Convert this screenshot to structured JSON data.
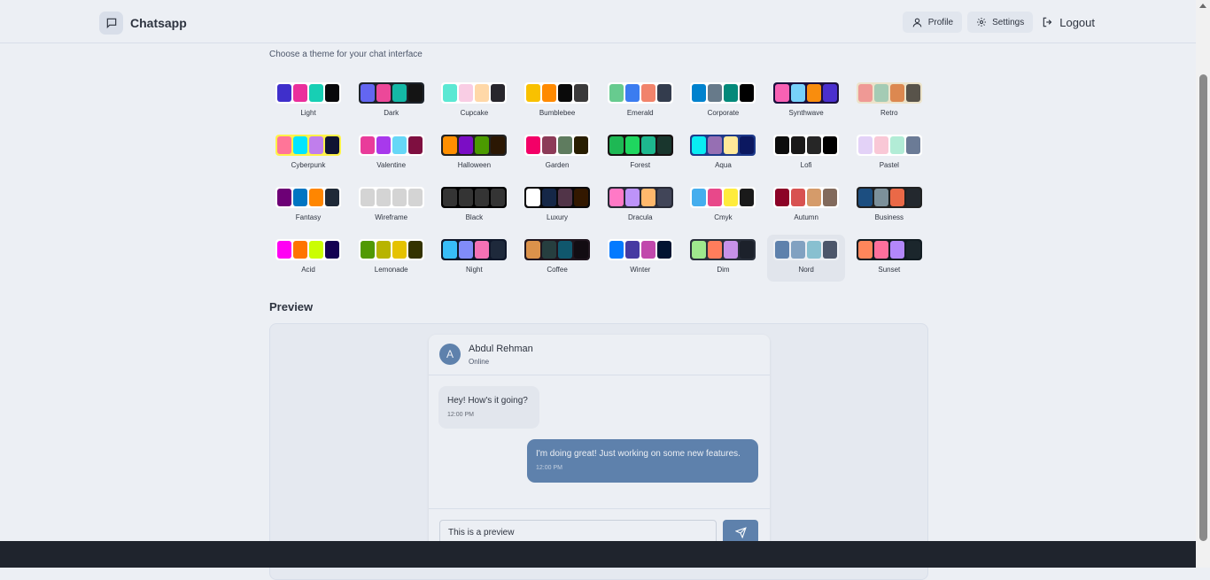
{
  "nav": {
    "brand": "Chatsapp",
    "profile": "Profile",
    "settings": "Settings",
    "logout": "Logout"
  },
  "subtitle": "Choose a theme for your chat interface",
  "selected_theme": "Nord",
  "themes": [
    {
      "name": "Light",
      "frame": "#ffffff",
      "colors": [
        "#3f2fcb",
        "#ea2f9c",
        "#17cfb4",
        "#09090b"
      ]
    },
    {
      "name": "Dark",
      "frame": "#1d232a",
      "colors": [
        "#6366f1",
        "#ec4899",
        "#14b8a6",
        "#141414"
      ]
    },
    {
      "name": "Cupcake",
      "frame": "#ffffff",
      "colors": [
        "#5be8d3",
        "#f9cde4",
        "#ffd8a8",
        "#28262c"
      ]
    },
    {
      "name": "Bumblebee",
      "frame": "#ffffff",
      "colors": [
        "#f9c100",
        "#ff8a00",
        "#0a0a0a",
        "#3b3a3a"
      ]
    },
    {
      "name": "Emerald",
      "frame": "#ffffff",
      "colors": [
        "#67cb8f",
        "#3b7cf0",
        "#f1836b",
        "#333c4d"
      ]
    },
    {
      "name": "Corporate",
      "frame": "#ffffff",
      "colors": [
        "#0082ce",
        "#677a8a",
        "#04897a",
        "#000000"
      ]
    },
    {
      "name": "Synthwave",
      "frame": "#1a103d",
      "colors": [
        "#f861b4",
        "#77d1fa",
        "#f98d0d",
        "#4a2fce"
      ]
    },
    {
      "name": "Retro",
      "frame": "#ece3ca",
      "colors": [
        "#ef9995",
        "#a4cbb4",
        "#dc8850",
        "#58534a"
      ]
    },
    {
      "name": "Cyberpunk",
      "frame": "#fff248",
      "colors": [
        "#ff7598",
        "#00e5ff",
        "#c07eec",
        "#0f1432"
      ]
    },
    {
      "name": "Valentine",
      "frame": "#ffffff",
      "colors": [
        "#e93c9a",
        "#a839ec",
        "#66d7f7",
        "#7e0f40"
      ]
    },
    {
      "name": "Halloween",
      "frame": "#212121",
      "colors": [
        "#ff8f00",
        "#7b0dc5",
        "#4b9b00",
        "#2b1703"
      ]
    },
    {
      "name": "Garden",
      "frame": "#ffffff",
      "colors": [
        "#f30067",
        "#8d3b58",
        "#5f7c5f",
        "#291e00"
      ]
    },
    {
      "name": "Forest",
      "frame": "#171212",
      "colors": [
        "#1eb854",
        "#1fd65f",
        "#1db88e",
        "#19362d"
      ]
    },
    {
      "name": "Aqua",
      "frame": "#1e3a8a",
      "colors": [
        "#09ecf3",
        "#966fb3",
        "#ffe999",
        "#0b1860"
      ]
    },
    {
      "name": "Lofi",
      "frame": "#ffffff",
      "colors": [
        "#0d0d0d",
        "#1a1919",
        "#262626",
        "#000000"
      ]
    },
    {
      "name": "Pastel",
      "frame": "#ffffff",
      "colors": [
        "#e3d2f7",
        "#f9c8d6",
        "#b2ecd6",
        "#6b7b96"
      ]
    },
    {
      "name": "Fantasy",
      "frame": "#ffffff",
      "colors": [
        "#6d0076",
        "#0075c2",
        "#ff8600",
        "#1f2937"
      ]
    },
    {
      "name": "Wireframe",
      "frame": "#ffffff",
      "colors": [
        "#d4d4d4",
        "#d4d4d4",
        "#d4d4d4",
        "#d4d4d4"
      ]
    },
    {
      "name": "Black",
      "frame": "#000000",
      "colors": [
        "#343434",
        "#343434",
        "#343434",
        "#343434"
      ]
    },
    {
      "name": "Luxury",
      "frame": "#09090b",
      "colors": [
        "#ffffff",
        "#152747",
        "#513448",
        "#331800"
      ]
    },
    {
      "name": "Dracula",
      "frame": "#282a36",
      "colors": [
        "#ff79c6",
        "#bd93f9",
        "#ffb86c",
        "#414558"
      ]
    },
    {
      "name": "Cmyk",
      "frame": "#ffffff",
      "colors": [
        "#45aeee",
        "#e8488a",
        "#ffec3c",
        "#1a1a1a"
      ]
    },
    {
      "name": "Autumn",
      "frame": "#ffffff",
      "colors": [
        "#8c0327",
        "#d85251",
        "#d59b6a",
        "#826a5c"
      ]
    },
    {
      "name": "Business",
      "frame": "#202020",
      "colors": [
        "#1c4e80",
        "#7c909a",
        "#ea6947",
        "#23282e"
      ]
    },
    {
      "name": "Acid",
      "frame": "#ffffff",
      "colors": [
        "#ff00f4",
        "#ff7400",
        "#cbfd03",
        "#140152"
      ]
    },
    {
      "name": "Lemonade",
      "frame": "#ffffff",
      "colors": [
        "#519903",
        "#b8b400",
        "#e5c200",
        "#343300"
      ]
    },
    {
      "name": "Night",
      "frame": "#0f172a",
      "colors": [
        "#38bdf8",
        "#818cf8",
        "#f471b5",
        "#1e293b"
      ]
    },
    {
      "name": "Coffee",
      "frame": "#20161f",
      "colors": [
        "#db924b",
        "#263e3f",
        "#10576d",
        "#120c12"
      ]
    },
    {
      "name": "Winter",
      "frame": "#ffffff",
      "colors": [
        "#047aff",
        "#463aa2",
        "#c148ac",
        "#021431"
      ]
    },
    {
      "name": "Dim",
      "frame": "#2a303c",
      "colors": [
        "#9fe88d",
        "#ff7d5c",
        "#c792e9",
        "#1c212b"
      ]
    },
    {
      "name": "Nord",
      "frame": "#eceff4",
      "colors": [
        "#5e81ac",
        "#81a1c1",
        "#88c0d0",
        "#4c566a"
      ]
    },
    {
      "name": "Sunset",
      "frame": "#121c22",
      "colors": [
        "#ff865b",
        "#fd6f9c",
        "#b387fa",
        "#1b262c"
      ]
    }
  ],
  "preview": {
    "title": "Preview",
    "contact_initial": "A",
    "contact_name": "Abdul Rehman",
    "contact_status": "Online",
    "messages": [
      {
        "text": "Hey! How's it going?",
        "time": "12:00 PM"
      },
      {
        "text": "I'm doing great! Just working on some new features.",
        "time": "12:00 PM"
      }
    ],
    "input_value": "This is a preview"
  }
}
